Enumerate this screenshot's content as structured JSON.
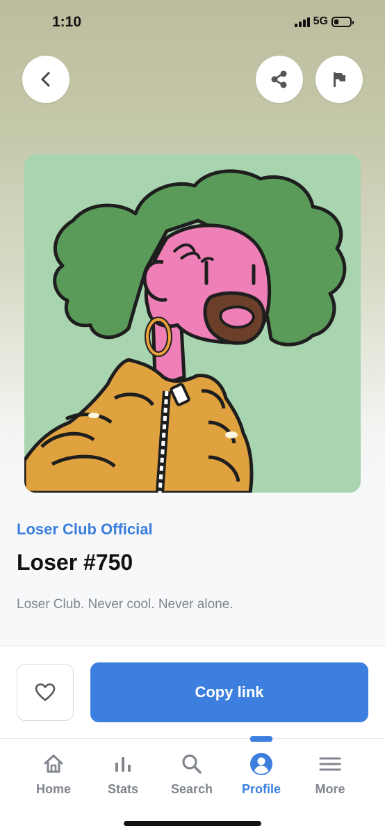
{
  "status_bar": {
    "time": "1:10",
    "network": "5G",
    "battery_level": 0.3
  },
  "header": {
    "back_icon": "chevron-left-icon",
    "share_icon": "share-icon",
    "flag_icon": "flag-icon"
  },
  "artwork": {
    "background_color": "#a9d4b0",
    "hair_color": "#5a9b5a",
    "skin_color": "#ef7fb7",
    "jacket_color": "#e0a23e",
    "beard_color": "#6b3f2a"
  },
  "item": {
    "collection": "Loser Club Official",
    "title": "Loser #750",
    "description": "Loser Club. Never cool. Never alone."
  },
  "actions": {
    "like_icon": "heart-outline-icon",
    "copy_link_label": "Copy link"
  },
  "tab_bar": {
    "tabs": [
      {
        "label": "Home",
        "icon": "home-icon",
        "active": false
      },
      {
        "label": "Stats",
        "icon": "bar-chart-icon",
        "active": false
      },
      {
        "label": "Search",
        "icon": "search-icon",
        "active": false
      },
      {
        "label": "Profile",
        "icon": "profile-icon",
        "active": true
      },
      {
        "label": "More",
        "icon": "menu-icon",
        "active": false
      }
    ]
  },
  "colors": {
    "accent": "#3d7fde",
    "text_primary": "#111111",
    "text_secondary": "#80858d"
  }
}
